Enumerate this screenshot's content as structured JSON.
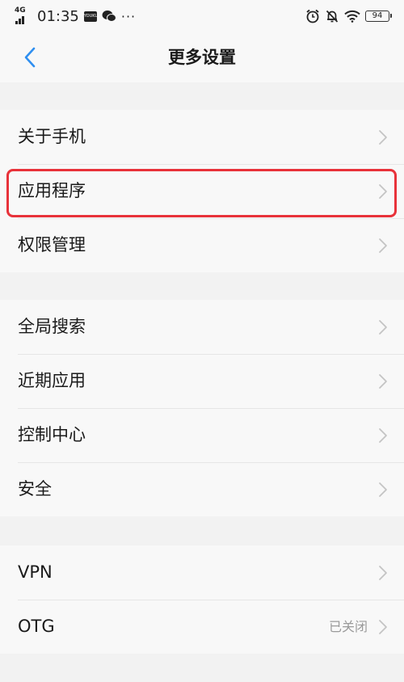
{
  "status_bar": {
    "network": "4G",
    "time": "01:35",
    "app_icon_label": "YOUKU",
    "more": "···",
    "battery": "94"
  },
  "nav": {
    "title": "更多设置"
  },
  "groups": [
    {
      "items": [
        {
          "label": "关于手机"
        },
        {
          "label": "应用程序",
          "highlighted": true
        },
        {
          "label": "权限管理"
        }
      ]
    },
    {
      "items": [
        {
          "label": "全局搜索"
        },
        {
          "label": "近期应用"
        },
        {
          "label": "控制中心"
        },
        {
          "label": "安全"
        }
      ]
    },
    {
      "items": [
        {
          "label": "VPN"
        },
        {
          "label": "OTG",
          "value": "已关闭"
        }
      ]
    }
  ],
  "icons": {
    "back": "chevron-left-icon",
    "row": "chevron-right-icon"
  },
  "colors": {
    "accent": "#2f8ff0",
    "highlight": "#e8323a",
    "background": "#f2f2f2",
    "card": "#f8f8f8"
  }
}
